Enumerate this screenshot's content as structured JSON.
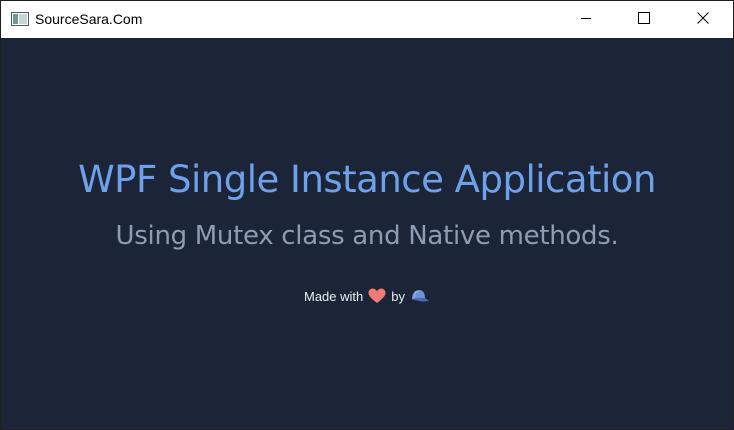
{
  "window": {
    "title": "SourceSara.Com",
    "app_icon": "window-app-icon",
    "controls": {
      "minimize_icon": "minimize-icon",
      "maximize_icon": "maximize-icon",
      "close_icon": "close-icon"
    }
  },
  "main": {
    "heading": "WPF Single Instance Application",
    "subheading": "Using Mutex class and Native methods.",
    "credit": {
      "made_with": "Made with",
      "heart_icon": "heart-icon",
      "by": "by",
      "author_icon": "cap-icon"
    }
  },
  "colors": {
    "background": "#1c2538",
    "heading": "#6ea0ec",
    "subheading": "#8e9cb4",
    "credit_text": "#e8ecf2",
    "heart": "#f07a76",
    "cap": "#6f8fd8"
  }
}
